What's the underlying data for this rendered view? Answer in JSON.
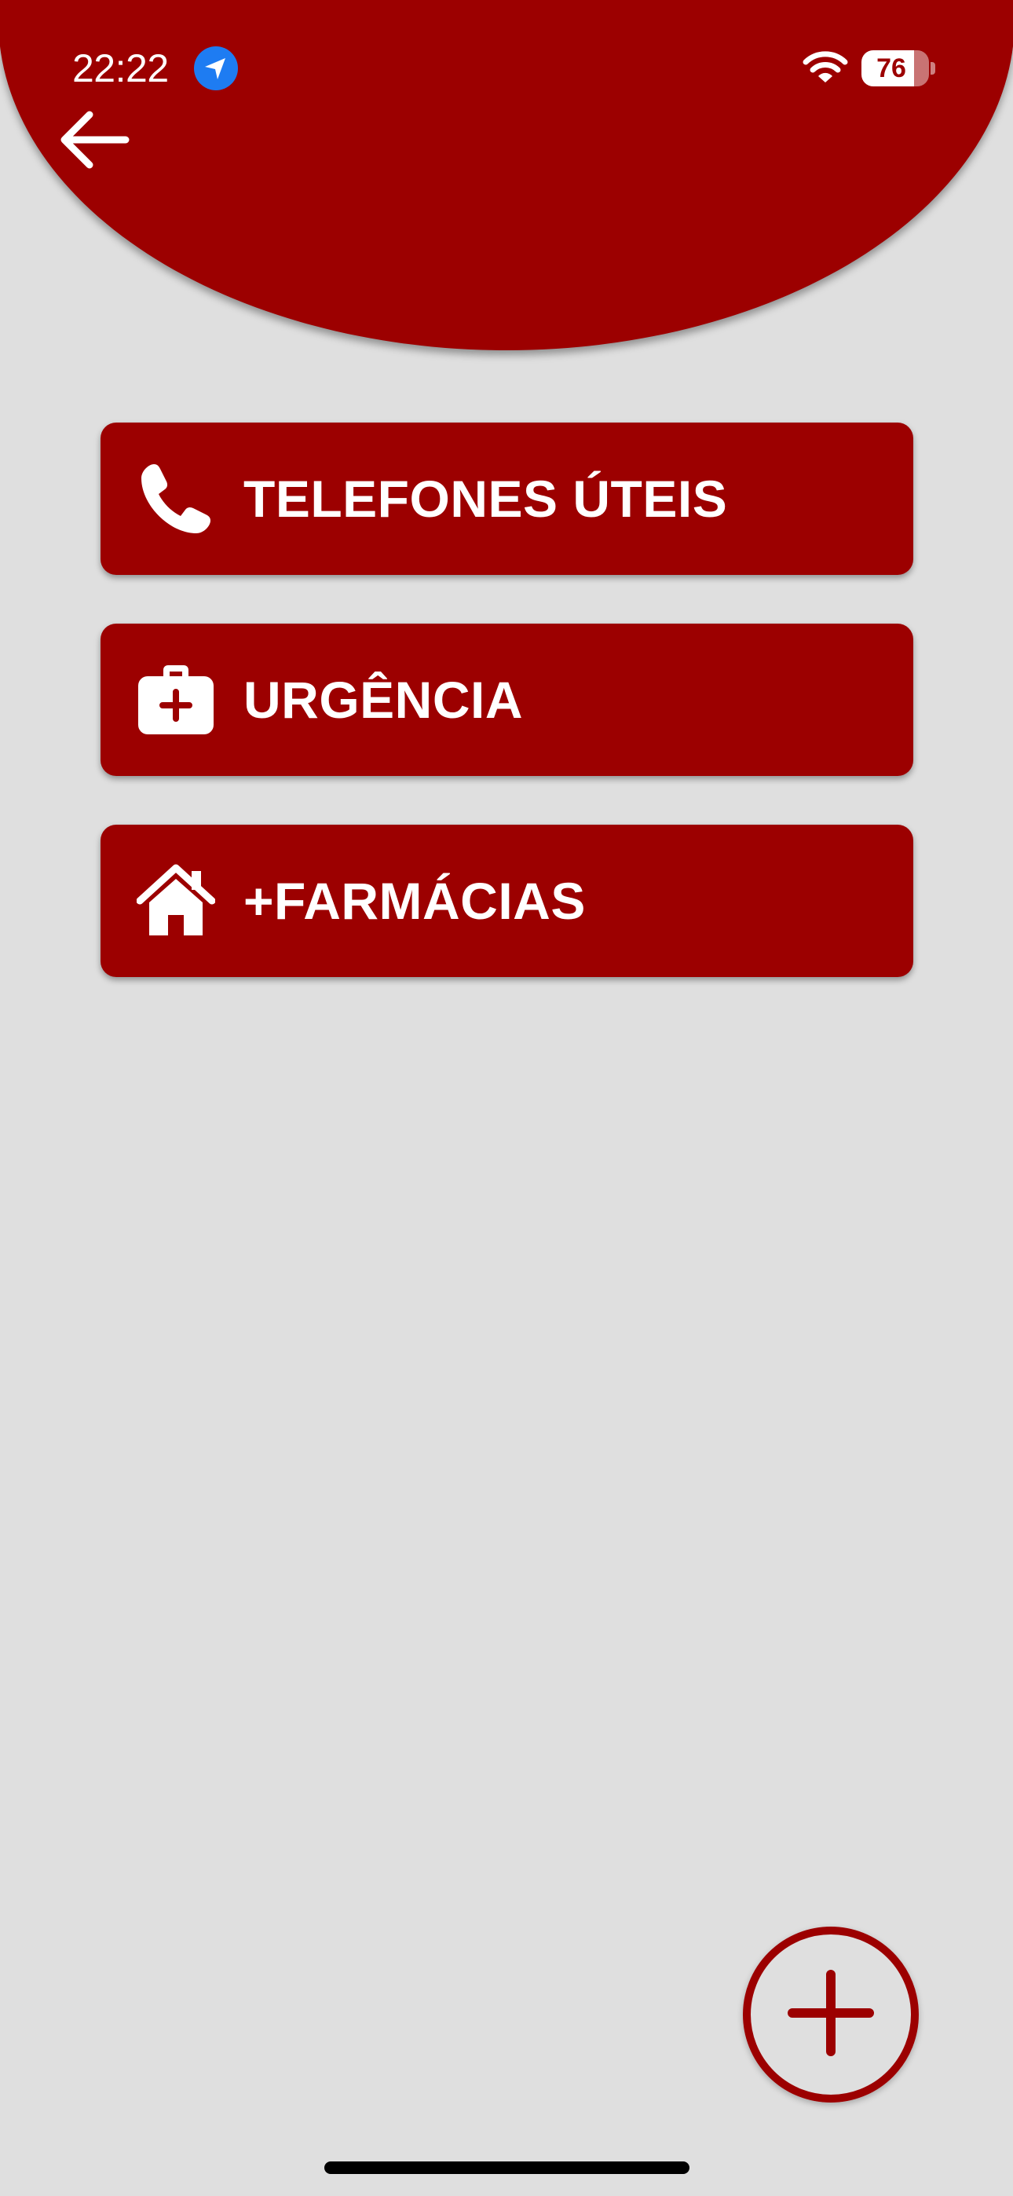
{
  "status_bar": {
    "time": "22:22",
    "battery_level": "76",
    "icons": [
      "location-arrow-icon",
      "wifi-icon",
      "battery-icon"
    ]
  },
  "header": {
    "back_icon": "arrow-left-icon"
  },
  "menu": {
    "items": [
      {
        "label": "TELEFONES ÚTEIS",
        "icon": "phone-icon"
      },
      {
        "label": "URGÊNCIA",
        "icon": "medical-kit-icon"
      },
      {
        "label": "+FARMÁCIAS",
        "icon": "house-icon"
      }
    ]
  },
  "fab": {
    "icon": "plus-icon"
  },
  "colors": {
    "primary": "#9c0000",
    "background": "#dfdfdf",
    "text_on_primary": "#ffffff",
    "location_badge": "#1e7cf2"
  }
}
